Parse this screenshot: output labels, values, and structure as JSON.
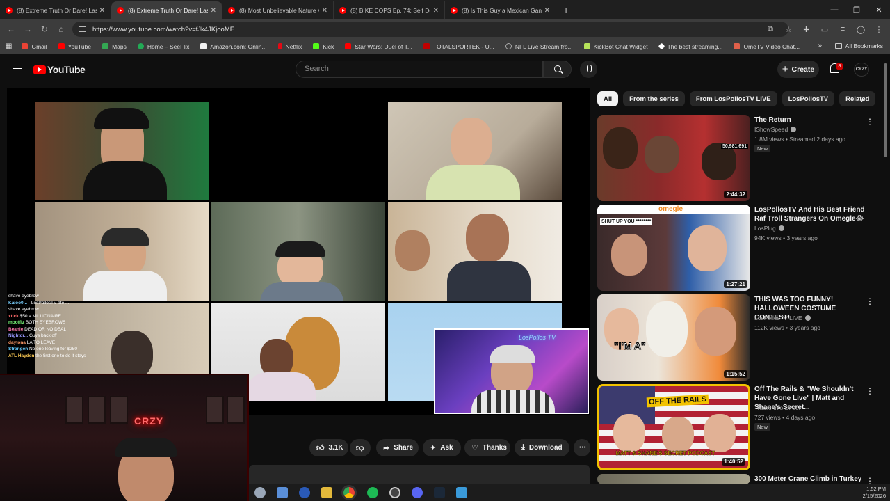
{
  "browser": {
    "tabs": [
      {
        "title": "(8) Extreme Truth Or Dare! Last"
      },
      {
        "title": "(8) Extreme Truth Or Dare! Last"
      },
      {
        "title": "(8) Most Unbelievable Nature V"
      },
      {
        "title": "(8) BIKE COPS Ep. 74: Self Defe"
      },
      {
        "title": "(8) Is This Guy a Mexican Gang"
      }
    ],
    "url": "https://www.youtube.com/watch?v=fJk4JKjooME",
    "bookmarks": [
      {
        "label": "Gmail",
        "color": "#ea4335"
      },
      {
        "label": "YouTube",
        "color": "#ff0000"
      },
      {
        "label": "Maps",
        "color": "#34a853"
      },
      {
        "label": "Home – SeeFlix",
        "color": "#22aa55"
      },
      {
        "label": "Amazon.com: Onlin...",
        "color": "#f2f2f2"
      },
      {
        "label": "Netflix",
        "color": "#e50914"
      },
      {
        "label": "Kick",
        "color": "#53fc18"
      },
      {
        "label": "Star Wars: Duel of T...",
        "color": "#ff0000"
      },
      {
        "label": "TOTALSPORTEK - U...",
        "color": "#c00000"
      },
      {
        "label": "NFL Live Stream fro...",
        "color": "#aaaaaa"
      },
      {
        "label": "KickBot Chat Widget",
        "color": "#b6e35a"
      },
      {
        "label": "The best streaming...",
        "color": "#ffffff"
      },
      {
        "label": "OmeTV Video Chat...",
        "color": "#e0604a"
      }
    ],
    "all_bookmarks": "All Bookmarks"
  },
  "youtube": {
    "logo": "YouTube",
    "search_placeholder": "Search",
    "create_label": "Create",
    "notif_count": "8",
    "avatar_text": "CRZY"
  },
  "player": {
    "chat_lines": [
      {
        "user": "",
        "msg": "shave eyebrow",
        "color": "#ffffff"
      },
      {
        "user": "Kaioo0...",
        "msg": "- LosPollosTV ate ...",
        "color": "#7ad0ff"
      },
      {
        "user": "",
        "msg": "shave eyebrow",
        "color": "#ffffff"
      },
      {
        "user": "xtick",
        "msg": "$50 a MILLIONAIRE",
        "color": "#ff6b6b"
      },
      {
        "user": "mooffiz",
        "msg": "BOTH EYEBROWS",
        "color": "#7cff7c"
      },
      {
        "user": "Beanie",
        "msg": "DEAD OR NO DEAL",
        "color": "#ff77aa"
      },
      {
        "user": "Nightdr...",
        "msg": "Guys back off",
        "color": "#9a9aff"
      },
      {
        "user": "daytona",
        "msg": "LA TO LEAVE",
        "color": "#ff9966"
      },
      {
        "user": "Strangen",
        "msg": "No one leaving for $250",
        "color": "#66ccff"
      },
      {
        "user": "ATL Hayden",
        "msg": "the first one to do it stays",
        "color": "#ffcc55"
      }
    ],
    "webcam_sign": "CRZY"
  },
  "actions": {
    "like_count": "3.1K",
    "share": "Share",
    "ask": "Ask",
    "thanks": "Thanks",
    "download": "Download"
  },
  "chips": [
    "All",
    "From the series",
    "From LosPollosTV LIVE",
    "LosPollosTV",
    "Related"
  ],
  "recommendations": [
    {
      "title": "The Return",
      "channel": "IShowSpeed",
      "verified": true,
      "meta": "1.8M views • Streamed 2 days ago",
      "badge": "New",
      "duration": "2:44:32"
    },
    {
      "title": "LosPollosTV And His Best Friend Raf Troll Strangers On Omegle😂",
      "channel": "LosPlug",
      "verified": true,
      "meta": "94K views • 3 years ago",
      "badge": "",
      "duration": "1:27:21"
    },
    {
      "title": "THIS WAS TOO FUNNY! HALLOWEEN COSTUME CONTEST!",
      "channel": "LosPollosTV LIVE",
      "verified": true,
      "meta": "112K views • 3 years ago",
      "badge": "",
      "duration": "1:15:52"
    },
    {
      "title": "Off The Rails & \"We Shouldn't Have Gone Live\" | Matt and Shane's Secret...",
      "channel": "Traoré Info Direct",
      "verified": false,
      "meta": "727 views • 4 days ago",
      "badge": "New",
      "duration": "1:40:52"
    },
    {
      "title": "300 Meter Crane Climb in Turkey",
      "channel": "",
      "verified": false,
      "meta": "",
      "badge": "",
      "duration": ""
    }
  ],
  "thumb_text": {
    "views_counter": "50,981,691",
    "omegle": "omegle",
    "shut_up": "SHUT UP YOU ********",
    "im_a": "\"I'M A\"",
    "off_rails": "OFF THE RAILS",
    "podcast": "MATT & SHANE'S SECRET PODCAST"
  },
  "taskbar": {
    "time": "1:52 PM",
    "date": "2/15/2026"
  }
}
